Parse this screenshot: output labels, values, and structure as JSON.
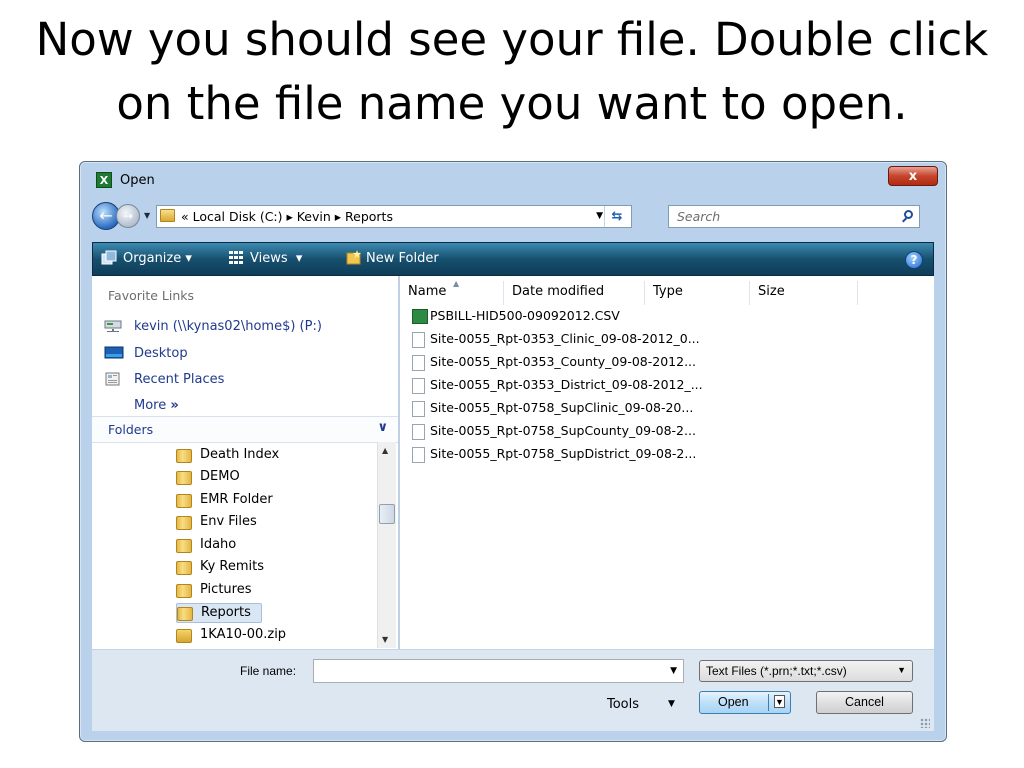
{
  "slide": {
    "title_line1": "Now you should see your file.  Double click",
    "title_line2": "on the file name you want to open."
  },
  "dialog": {
    "title": "Open",
    "app_icon": "excel-icon",
    "close_label": "x",
    "address": {
      "path": "«  Local Disk (C:)  ▸  Kevin  ▸  Reports",
      "segments": [
        "Local Disk (C:)",
        "Kevin",
        "Reports"
      ]
    },
    "search": {
      "placeholder": "Search"
    },
    "toolbar": {
      "organize": "Organize",
      "views": "Views",
      "new_folder": "New Folder"
    },
    "sidebar": {
      "favorite_links_heading": "Favorite Links",
      "favorites": [
        {
          "label": "kevin (\\\\kynas02\\home$) (P:)",
          "icon": "network-drive-icon"
        },
        {
          "label": "Desktop",
          "icon": "desktop-icon"
        },
        {
          "label": "Recent Places",
          "icon": "recent-places-icon"
        }
      ],
      "more": "More",
      "more_chevron": "»",
      "folders_heading": "Folders",
      "folders": [
        {
          "label": "Death Index",
          "selected": false
        },
        {
          "label": "DEMO",
          "selected": false
        },
        {
          "label": "EMR Folder",
          "selected": false
        },
        {
          "label": "Env Files",
          "selected": false
        },
        {
          "label": "Idaho",
          "selected": false
        },
        {
          "label": "Ky Remits",
          "selected": false
        },
        {
          "label": "Pictures",
          "selected": false
        },
        {
          "label": "Reports",
          "selected": true
        },
        {
          "label": "1KA10-00.zip",
          "selected": false
        }
      ]
    },
    "columns": [
      "Name",
      "Date modified",
      "Type",
      "Size"
    ],
    "files": [
      {
        "name": "PSBILL-HID500-09092012.CSV",
        "icon": "csv-file-icon"
      },
      {
        "name": "Site-0055_Rpt-0353_Clinic_09-08-2012_0...",
        "icon": "text-file-icon"
      },
      {
        "name": "Site-0055_Rpt-0353_County_09-08-2012...",
        "icon": "text-file-icon"
      },
      {
        "name": "Site-0055_Rpt-0353_District_09-08-2012_...",
        "icon": "text-file-icon"
      },
      {
        "name": "Site-0055_Rpt-0758_SupClinic_09-08-20...",
        "icon": "text-file-icon"
      },
      {
        "name": "Site-0055_Rpt-0758_SupCounty_09-08-2...",
        "icon": "text-file-icon"
      },
      {
        "name": "Site-0055_Rpt-0758_SupDistrict_09-08-2...",
        "icon": "text-file-icon"
      }
    ],
    "footer": {
      "file_name_label": "File name:",
      "file_name_value": "",
      "filter": "Text Files (*.prn;*.txt;*.csv)",
      "tools": "Tools",
      "open": "Open",
      "cancel": "Cancel"
    }
  }
}
